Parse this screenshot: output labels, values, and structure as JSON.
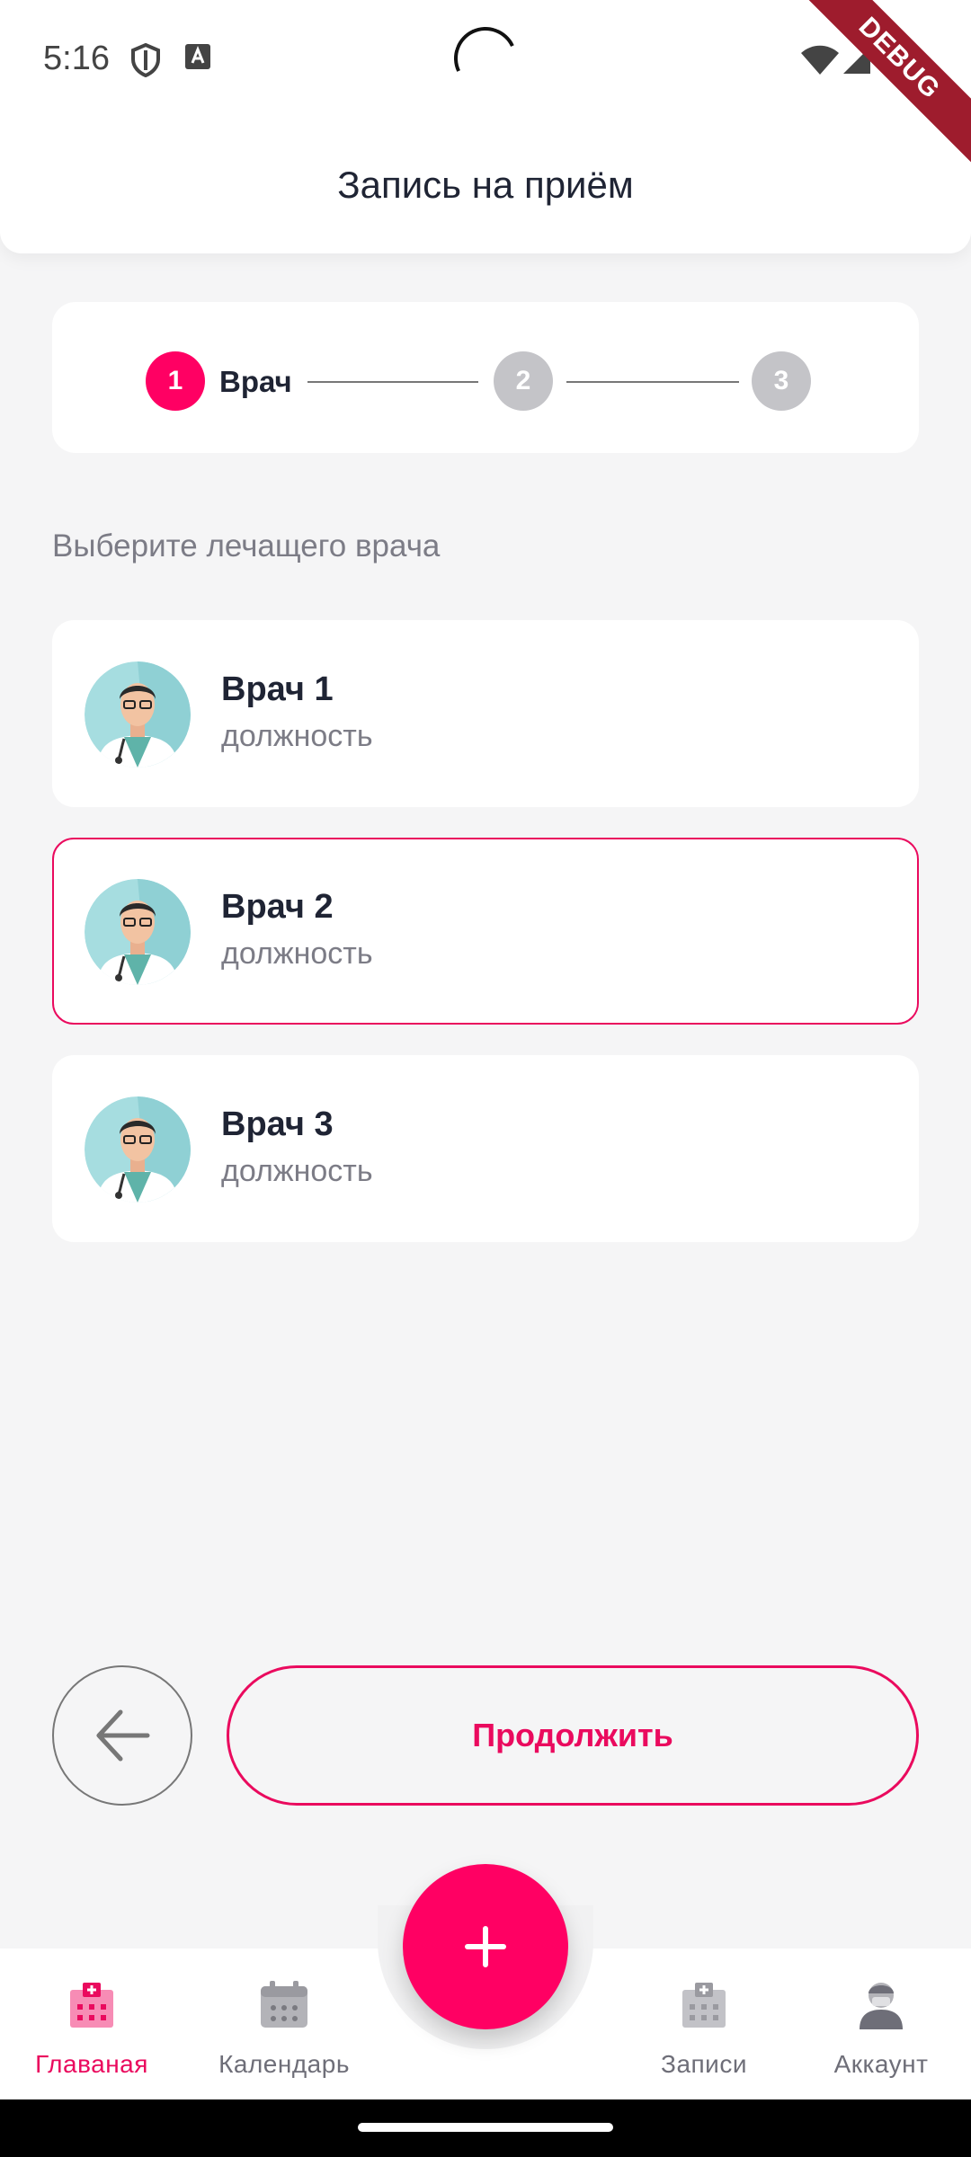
{
  "status_bar": {
    "time": "5:16",
    "debug_label": "DEBUG"
  },
  "header": {
    "title": "Запись на приём"
  },
  "stepper": {
    "steps": [
      {
        "number": "1",
        "label": "Врач",
        "active": true
      },
      {
        "number": "2",
        "label": "",
        "active": false
      },
      {
        "number": "3",
        "label": "",
        "active": false
      }
    ]
  },
  "section_label": "Выберите лечащего врача",
  "doctors": [
    {
      "name": "Врач 1",
      "position": "должность",
      "selected": false
    },
    {
      "name": "Врач 2",
      "position": "должность",
      "selected": true
    },
    {
      "name": "Врач 3",
      "position": "должность",
      "selected": false
    }
  ],
  "actions": {
    "continue_label": "Продолжить",
    "back_icon": "arrow-left-icon"
  },
  "fab": {
    "icon": "plus-icon"
  },
  "bottom_nav": {
    "items": [
      {
        "label": "Главаная",
        "icon": "hospital-icon",
        "active": true
      },
      {
        "label": "Календарь",
        "icon": "calendar-icon",
        "active": false
      },
      {
        "label": "Записи",
        "icon": "records-icon",
        "active": false
      },
      {
        "label": "Аккаунт",
        "icon": "doctor-account-icon",
        "active": false
      }
    ]
  },
  "colors": {
    "accent": "#ea0a5e",
    "fab": "#ff0063",
    "inactive_step": "#c4c4c8",
    "background": "#f5f5f6"
  }
}
